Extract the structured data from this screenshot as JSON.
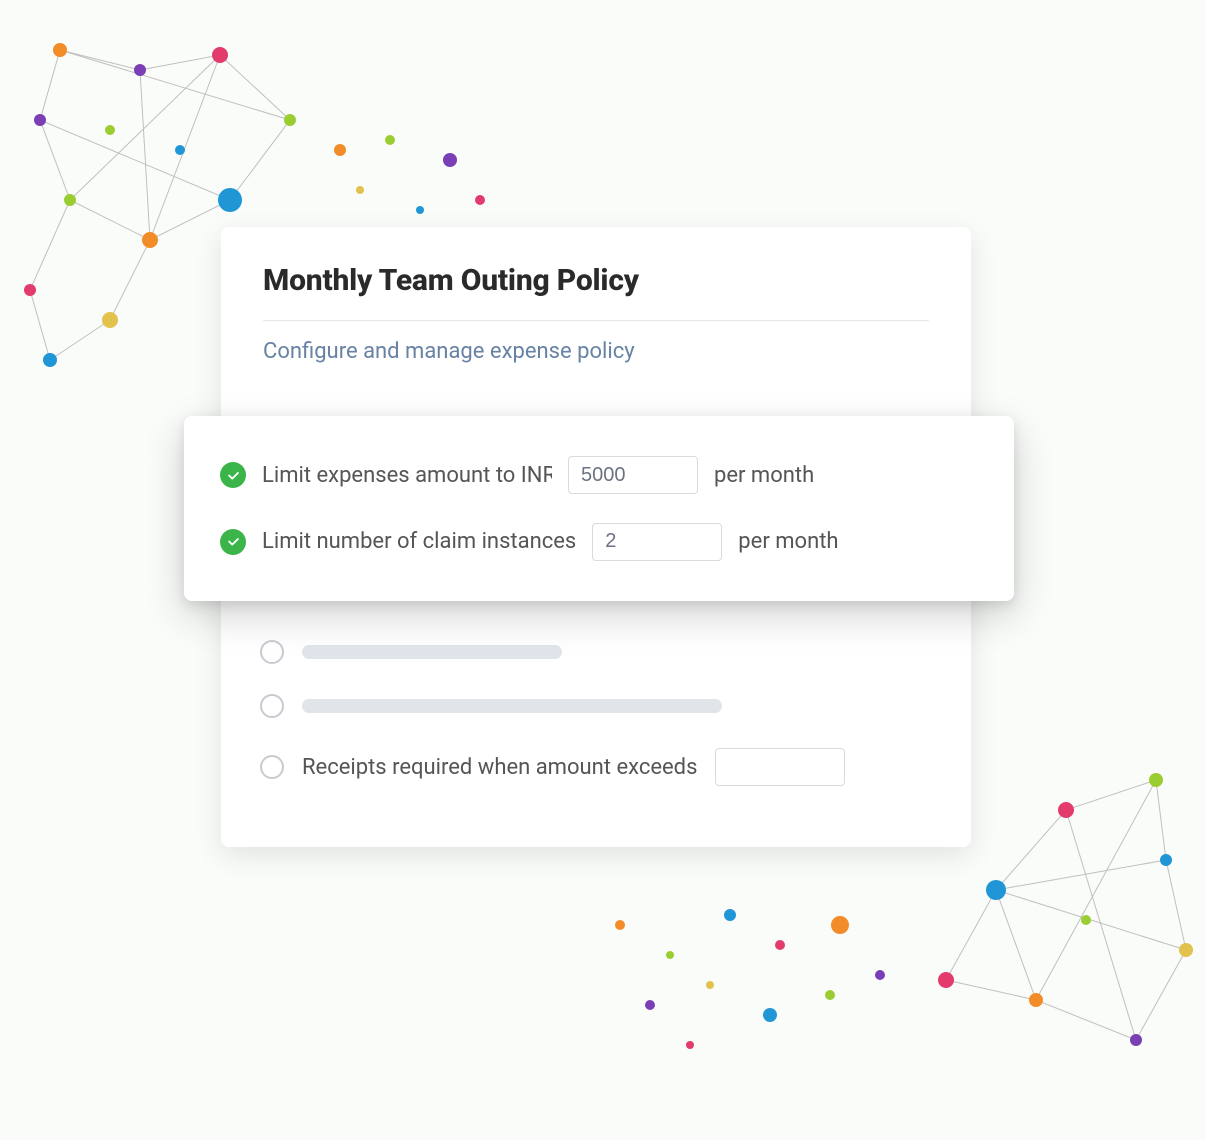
{
  "card": {
    "title": "Monthly Team Outing Policy",
    "subtitle": "Configure and manage expense policy"
  },
  "rules": {
    "rule1": {
      "prefix": "Limit expenses amount to INR",
      "value": "5000",
      "suffix": "per month"
    },
    "rule2": {
      "prefix": "Limit number of claim instances",
      "value": "2",
      "suffix": "per month"
    },
    "rule3": {
      "label": "Receipts required when amount exceeds",
      "value": ""
    }
  }
}
